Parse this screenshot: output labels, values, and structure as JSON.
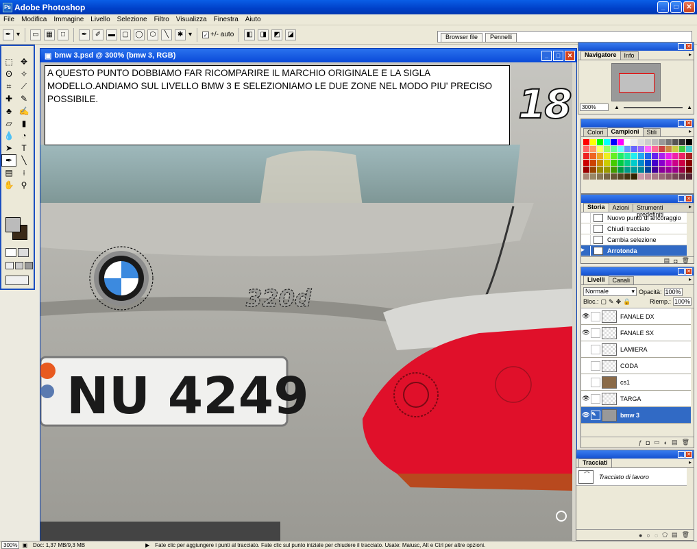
{
  "app": {
    "title": "Adobe Photoshop",
    "icon": "Ps"
  },
  "menu": [
    "File",
    "Modifica",
    "Immagine",
    "Livello",
    "Selezione",
    "Filtro",
    "Visualizza",
    "Finestra",
    "Aiuto"
  ],
  "options": {
    "autoLabel": "+/- auto"
  },
  "wells": [
    "Browser file",
    "Pennelli"
  ],
  "document": {
    "title": "bmw 3.psd @ 300% (bmw 3, RGB)",
    "plate": "NU 4249",
    "badge": "320d"
  },
  "note": "A QUESTO PUNTO DOBBIAMO FAR RICOMPARIRE IL MARCHIO ORIGINALE E LA SIGLA MODELLO.ANDIAMO SUL LIVELLO BMW 3 E SELEZIONIAMO LE DUE ZONE NEL MODO PIU' PRECISO POSSIBILE.",
  "stepNumber": "18",
  "navigator": {
    "tabs": [
      "Navigatore",
      "Info"
    ],
    "zoom": "300%"
  },
  "swatches": {
    "tabs": [
      "Colori",
      "Campioni",
      "Stili"
    ]
  },
  "history": {
    "tabs": [
      "Storia",
      "Azioni",
      "Strumenti predefiniti"
    ],
    "items": [
      "Nuovo punto di ancoraggio",
      "Chiudi tracciato",
      "Cambia selezione",
      "Arrotonda"
    ]
  },
  "layers": {
    "tabs": [
      "Livelli",
      "Canali"
    ],
    "blend": "Normale",
    "opacityLabel": "Opacità:",
    "opacity": "100%",
    "lockLabel": "Bloc.:",
    "fillLabel": "Riemp.:",
    "fill": "100%",
    "items": [
      "FANALE DX",
      "FANALE SX",
      "LAMIERA",
      "CODA",
      "cs1",
      "TARGA",
      "bmw 3"
    ]
  },
  "paths": {
    "tabs": [
      "Tracciati"
    ],
    "items": [
      "Tracciato di lavoro"
    ]
  },
  "status": {
    "zoom": "300%",
    "doc": "Doc: 1,37 MB/9,3 MB",
    "hint": "Fate clic per aggiungere i punti al tracciato. Fate clic sul punto iniziale per chiudere il tracciato. Usate: Maiusc, Alt e Ctrl per altre opzioni."
  },
  "colors": {
    "titleBlue": "#0a4ad8",
    "selection": "#316ac5",
    "taillight": "#e0102a"
  }
}
